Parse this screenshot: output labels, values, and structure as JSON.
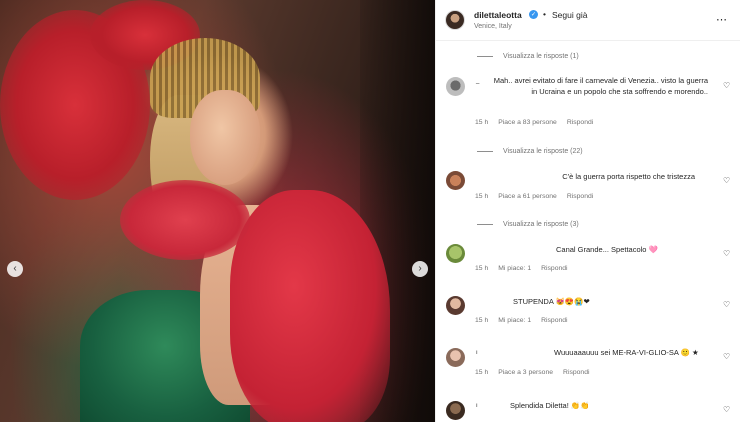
{
  "post": {
    "username": "dilettaleotta",
    "verified_icon": "verified-badge-icon",
    "separator": "•",
    "follow_state": "Segui già",
    "location": "Venice, Italy",
    "more_icon": "⋯"
  },
  "carousel": {
    "prev": "‹",
    "next": "›"
  },
  "threads": [
    {
      "view_replies": "Visualizza le risposte (1)",
      "comment": {
        "name_fragment": "_",
        "text": "Mah.. avrei evitato di fare il carnevale di Venezia.. visto la guerra in Ucraina e un popolo che sta soffrendo e morendo..",
        "time": "15 h",
        "likes": "Piace a 83 persone",
        "reply": "Rispondi"
      }
    },
    {
      "view_replies": "Visualizza le risposte (22)",
      "comment": {
        "name_fragment": "",
        "text": "C'è la guerra porta rispetto che tristezza",
        "time": "15 h",
        "likes": "Piace a 61 persone",
        "reply": "Rispondi"
      }
    },
    {
      "view_replies": "Visualizza le risposte (3)",
      "comment": {
        "name_fragment": "",
        "text": "Canal Grande... Spettacolo 🩷",
        "time": "15 h",
        "likes": "Mi piace: 1",
        "reply": "Rispondi"
      }
    }
  ],
  "comments": [
    {
      "name_fragment": "",
      "text": "STUPENDA 😻😍😭❤",
      "time": "15 h",
      "likes": "Mi piace: 1",
      "reply": "Rispondi"
    },
    {
      "name_fragment": "ı",
      "text": "Wuuuaaauuu sei ME-RA-VI-GLIO-SA 🙂 ★",
      "time": "15 h",
      "likes": "Piace a 3 persone",
      "reply": "Rispondi"
    },
    {
      "name_fragment": "ı",
      "text": "Splendida Diletta! 👏👏",
      "time": "",
      "likes": "",
      "reply": ""
    }
  ],
  "icons": {
    "heart": "♡"
  },
  "colors": {
    "verified": "#3897f0",
    "muted": "#737373",
    "text": "#262626"
  }
}
